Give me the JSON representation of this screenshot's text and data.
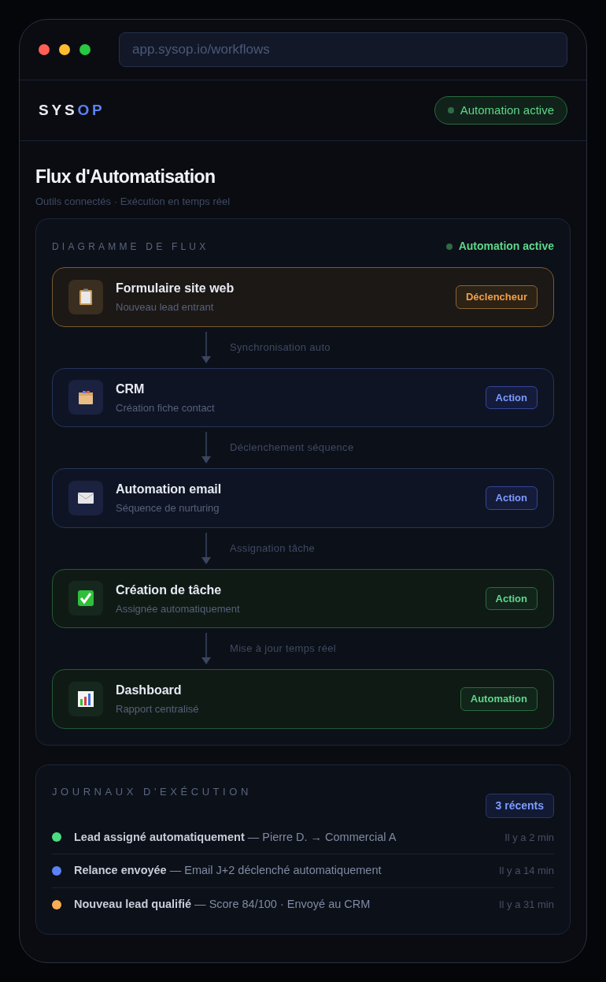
{
  "browser": {
    "url": "app.sysop.io/workflows"
  },
  "header": {
    "logo_main": "SYS",
    "logo_accent": "OP",
    "status": "Automation active"
  },
  "page": {
    "title": "Flux d'Automatisation",
    "subtitle": "Outils connectés · Exécution en temps réel"
  },
  "diagram": {
    "heading": "DIAGRAMME DE FLUX",
    "status": "Automation active",
    "nodes": [
      {
        "title": "Formulaire site web",
        "subtitle": "Nouveau lead entrant",
        "badge": "Déclencheur",
        "kind": "trigger"
      },
      {
        "title": "CRM",
        "subtitle": "Création fiche contact",
        "badge": "Action",
        "kind": "action"
      },
      {
        "title": "Automation email",
        "subtitle": "Séquence de nurturing",
        "badge": "Action",
        "kind": "action"
      },
      {
        "title": "Création de tâche",
        "subtitle": "Assignée automatiquement",
        "badge": "Action",
        "kind": "done"
      },
      {
        "title": "Dashboard",
        "subtitle": "Rapport centralisé",
        "badge": "Automation",
        "kind": "done"
      }
    ],
    "connectors": [
      "Synchronisation auto",
      "Déclenchement séquence",
      "Assignation tâche",
      "Mise à jour temps réel"
    ]
  },
  "logs": {
    "heading": "JOURNAUX D'EXÉCUTION",
    "badge": "3 récents",
    "items": [
      {
        "text": "**Lead assigné automatiquement** — Pierre D. → Commercial A",
        "time": "Il y a 2 min",
        "color": "#4ade80"
      },
      {
        "text": "**Relance envoyée** — Email J+2 déclenché automatiquement",
        "time": "Il y a 14 min",
        "color": "#5b82f6"
      },
      {
        "text": "**Nouveau lead qualifié** — Score 84/100 · Envoyé au CRM",
        "time": "Il y a 31 min",
        "color": "#fbad55"
      }
    ]
  }
}
